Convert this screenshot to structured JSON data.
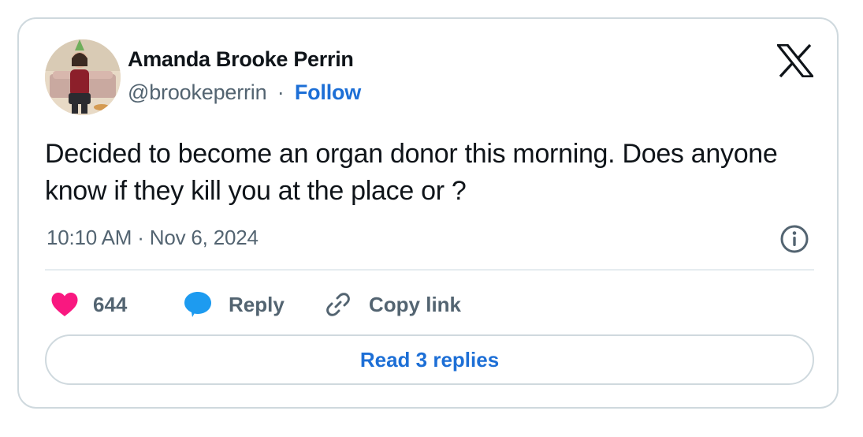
{
  "author": {
    "display_name": "Amanda Brooke Perrin",
    "handle": "@brookeperrin",
    "separator": "·",
    "follow_label": "Follow"
  },
  "tweet": {
    "text": "Decided to become an organ donor this morning. Does anyone know if they kill you at the place or ?",
    "timestamp": "10:10 AM · Nov 6, 2024"
  },
  "actions": {
    "like_count": "644",
    "reply_label": "Reply",
    "copy_label": "Copy link"
  },
  "read_replies_label": "Read 3 replies",
  "icons": {
    "brand": "x-logo-icon",
    "info": "info-icon",
    "like": "heart-icon",
    "reply": "speech-bubble-icon",
    "copy": "link-icon"
  },
  "colors": {
    "like": "#f91880",
    "reply": "#1d9bf0",
    "link": "#1d6fd6",
    "secondary_text": "#536471",
    "border": "#cfd9de"
  }
}
